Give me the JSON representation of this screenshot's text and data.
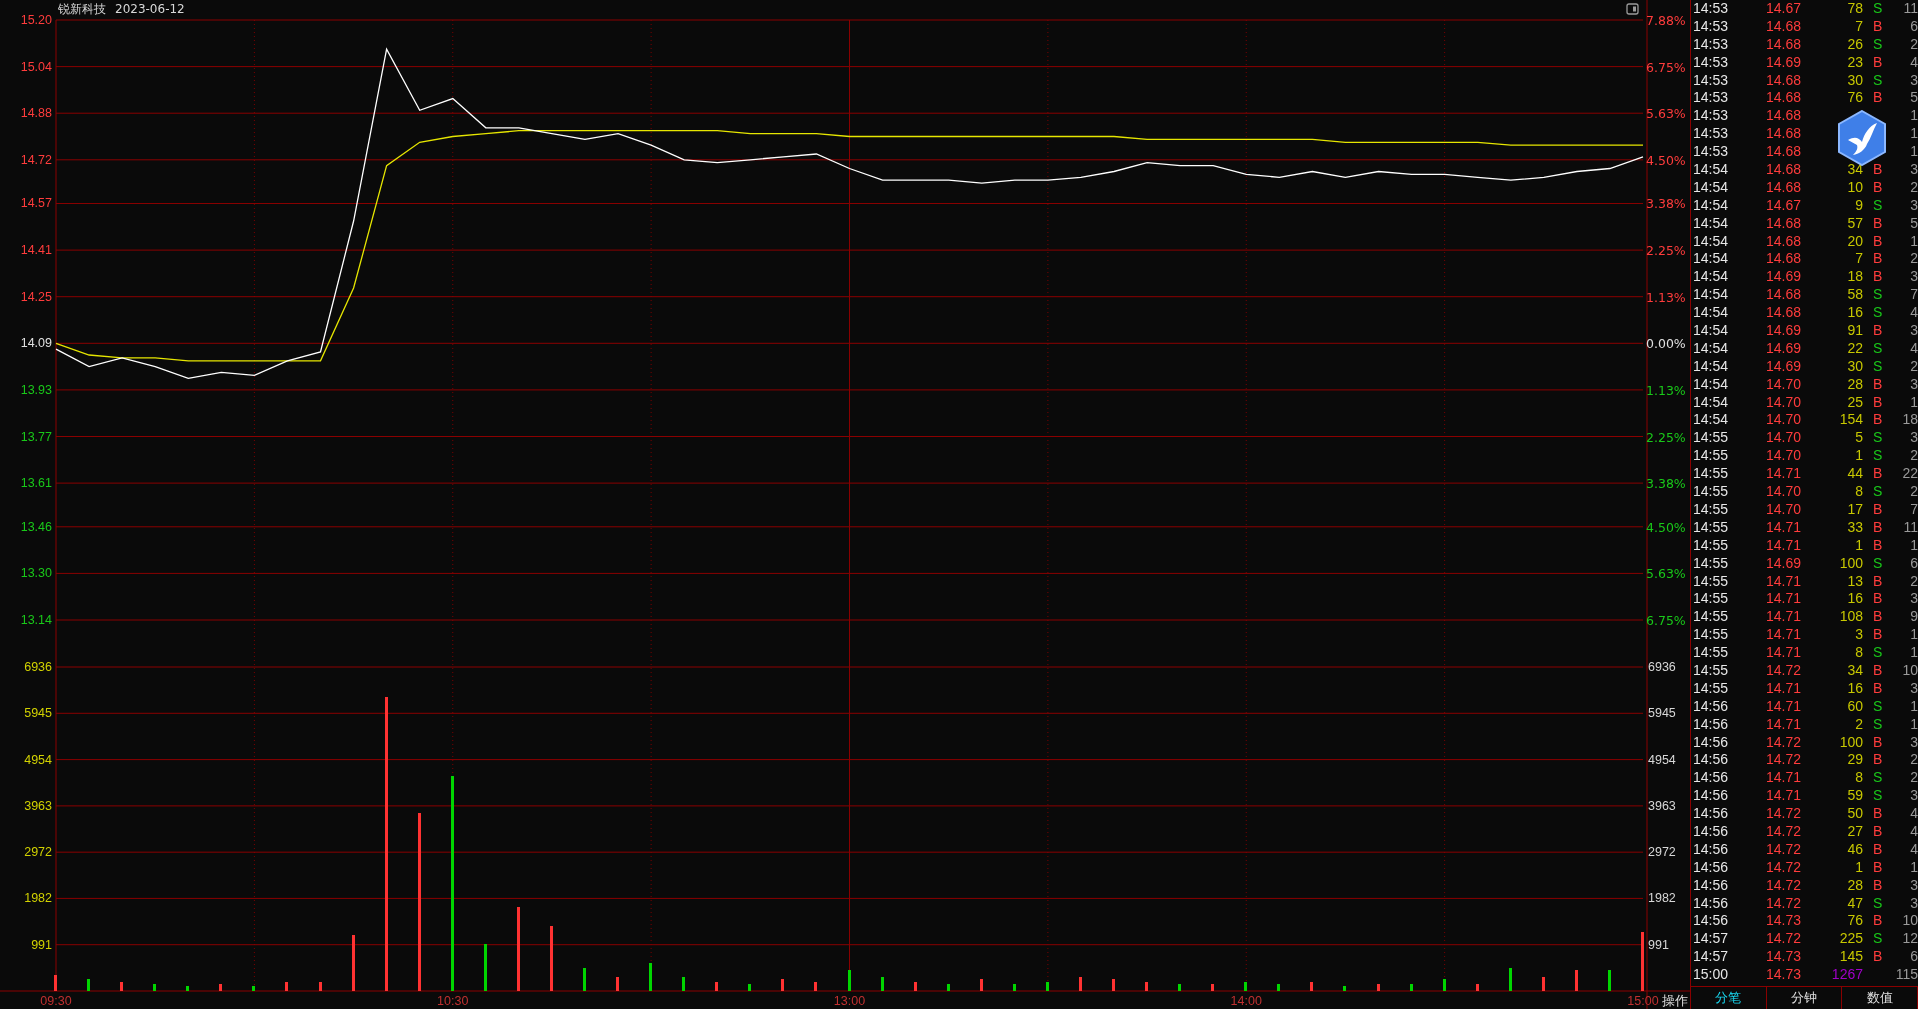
{
  "header": {
    "name": "锐新科技",
    "date": "2023-06-12"
  },
  "price_chart": {
    "chart_data": {
      "type": "line",
      "grid": true,
      "ylim": [
        13.14,
        15.2
      ],
      "yticks": [
        {
          "value": 15.2,
          "label": "15.20"
        },
        {
          "value": 15.04,
          "label": "15.04"
        },
        {
          "value": 14.88,
          "label": "14.88"
        },
        {
          "value": 14.72,
          "label": "14.72"
        },
        {
          "value": 14.57,
          "label": "14.57"
        },
        {
          "value": 14.41,
          "label": "14.41"
        },
        {
          "value": 14.25,
          "label": "14.25"
        },
        {
          "value": 14.09,
          "label": "14.09"
        },
        {
          "value": 13.93,
          "label": "13.93"
        },
        {
          "value": 13.77,
          "label": "13.77"
        },
        {
          "value": 13.61,
          "label": "13.61"
        },
        {
          "value": 13.46,
          "label": "13.46"
        },
        {
          "value": 13.3,
          "label": "13.30"
        },
        {
          "value": 13.14,
          "label": "13.14"
        }
      ],
      "series": [
        {
          "color": "#ffffff",
          "values": [
            14.07,
            14.01,
            14.04,
            14.01,
            13.97,
            13.99,
            13.98,
            14.03,
            14.06,
            14.51,
            15.1,
            14.89,
            14.93,
            14.83,
            14.83,
            14.81,
            14.79,
            14.81,
            14.77,
            14.72,
            14.71,
            14.72,
            14.73,
            14.74,
            14.69,
            14.65,
            14.65,
            14.65,
            14.64,
            14.65,
            14.65,
            14.66,
            14.68,
            14.71,
            14.7,
            14.7,
            14.67,
            14.66,
            14.68,
            14.66,
            14.68,
            14.67,
            14.67,
            14.66,
            14.65,
            14.66,
            14.68,
            14.69,
            14.73
          ]
        },
        {
          "color": "#e6e600",
          "values": [
            14.09,
            14.05,
            14.04,
            14.04,
            14.03,
            14.03,
            14.03,
            14.03,
            14.03,
            14.28,
            14.7,
            14.78,
            14.8,
            14.81,
            14.82,
            14.82,
            14.82,
            14.82,
            14.82,
            14.82,
            14.82,
            14.81,
            14.81,
            14.81,
            14.8,
            14.8,
            14.8,
            14.8,
            14.8,
            14.8,
            14.8,
            14.8,
            14.8,
            14.79,
            14.79,
            14.79,
            14.79,
            14.79,
            14.79,
            14.78,
            14.78,
            14.78,
            14.78,
            14.78,
            14.77,
            14.77,
            14.77,
            14.77,
            14.77
          ]
        }
      ]
    },
    "right_ticks": [
      {
        "label": "7.88%",
        "color": "#ff3c3c"
      },
      {
        "label": "6.75%",
        "color": "#ff3c3c"
      },
      {
        "label": "5.63%",
        "color": "#ff3c3c"
      },
      {
        "label": "4.50%",
        "color": "#ff3c3c"
      },
      {
        "label": "3.38%",
        "color": "#ff3c3c"
      },
      {
        "label": "2.25%",
        "color": "#ff3c3c"
      },
      {
        "label": "1.13%",
        "color": "#ff3c3c"
      },
      {
        "label": "0.00%",
        "color": "#e0e0e0"
      },
      {
        "label": "1.13%",
        "color": "#19c819"
      },
      {
        "label": "2.25%",
        "color": "#19c819"
      },
      {
        "label": "3.38%",
        "color": "#19c819"
      },
      {
        "label": "4.50%",
        "color": "#19c819"
      },
      {
        "label": "5.63%",
        "color": "#19c819"
      },
      {
        "label": "6.75%",
        "color": "#19c819"
      }
    ]
  },
  "volume_chart": {
    "chart_data": {
      "type": "bar",
      "grid": true,
      "categories": [
        "09:30",
        null,
        null,
        null,
        null,
        null,
        null,
        null,
        null,
        null,
        null,
        null,
        "10:30",
        null,
        null,
        null,
        null,
        null,
        null,
        null,
        null,
        null,
        null,
        null,
        "13:00",
        null,
        null,
        null,
        null,
        null,
        null,
        null,
        null,
        null,
        null,
        null,
        "14:00",
        null,
        null,
        null,
        null,
        null,
        null,
        null,
        null,
        null,
        null,
        null,
        "15:00"
      ],
      "ylim": [
        0,
        6936
      ],
      "yticks": [
        6936,
        5945,
        4954,
        3963,
        2972,
        1982,
        991
      ],
      "series": [
        {
          "values": [
            350,
            250,
            200,
            150,
            100,
            150,
            100,
            200,
            200,
            1200,
            6300,
            3800,
            4600,
            1000,
            1800,
            1400,
            500,
            300,
            600,
            300,
            200,
            150,
            250,
            200,
            450,
            300,
            200,
            150,
            250,
            150,
            200,
            300,
            250,
            200,
            150,
            150,
            200,
            150,
            200,
            100,
            150,
            150,
            250,
            150,
            500,
            300,
            450,
            450,
            1270
          ]
        }
      ]
    },
    "bar_up": [
      true,
      false,
      true,
      false,
      false,
      true,
      false,
      true,
      true,
      true,
      true,
      true,
      false,
      false,
      true,
      true,
      false,
      true,
      false,
      false,
      true,
      false,
      true,
      true,
      false,
      false,
      true,
      false,
      true,
      false,
      false,
      true,
      true,
      true,
      false,
      true,
      false,
      false,
      true,
      false,
      true,
      false,
      false,
      true,
      false,
      true,
      true,
      false,
      true
    ],
    "right_ticks": [
      "6936",
      "5945",
      "4954",
      "3963",
      "2972",
      "1982",
      "991"
    ]
  },
  "action_label": "操作",
  "trades": [
    {
      "kind": "trade",
      "time": "14:53",
      "price": "14.67",
      "volume": "78",
      "side": "S",
      "buy": false,
      "count": "11"
    },
    {
      "kind": "trade",
      "time": "14:53",
      "price": "14.68",
      "volume": "7",
      "side": "B",
      "buy": true,
      "count": "6"
    },
    {
      "kind": "trade",
      "time": "14:53",
      "price": "14.68",
      "volume": "26",
      "side": "S",
      "buy": false,
      "count": "2"
    },
    {
      "kind": "trade",
      "time": "14:53",
      "price": "14.69",
      "volume": "23",
      "side": "B",
      "buy": true,
      "count": "4"
    },
    {
      "kind": "trade",
      "time": "14:53",
      "price": "14.68",
      "volume": "30",
      "side": "S",
      "buy": false,
      "count": "3"
    },
    {
      "kind": "trade",
      "time": "14:53",
      "price": "14.68",
      "volume": "76",
      "side": "B",
      "buy": true,
      "count": "5"
    },
    {
      "kind": "trade",
      "time": "14:53",
      "price": "14.68",
      "count": "1"
    },
    {
      "kind": "trade",
      "time": "14:53",
      "price": "14.68",
      "count": "1"
    },
    {
      "kind": "trade",
      "time": "14:53",
      "price": "14.68",
      "count": "1"
    },
    {
      "kind": "trade",
      "time": "14:54",
      "price": "14.68",
      "volume": "34",
      "side": "B",
      "buy": true,
      "count": "3"
    },
    {
      "kind": "trade",
      "time": "14:54",
      "price": "14.68",
      "volume": "10",
      "side": "B",
      "buy": true,
      "count": "2"
    },
    {
      "kind": "trade",
      "time": "14:54",
      "price": "14.67",
      "volume": "9",
      "side": "S",
      "buy": false,
      "count": "3"
    },
    {
      "kind": "trade",
      "time": "14:54",
      "price": "14.68",
      "volume": "57",
      "side": "B",
      "buy": true,
      "count": "5"
    },
    {
      "kind": "trade",
      "time": "14:54",
      "price": "14.68",
      "volume": "20",
      "side": "B",
      "buy": true,
      "count": "1"
    },
    {
      "kind": "trade",
      "time": "14:54",
      "price": "14.68",
      "volume": "7",
      "side": "B",
      "buy": true,
      "count": "2"
    },
    {
      "kind": "trade",
      "time": "14:54",
      "price": "14.69",
      "volume": "18",
      "side": "B",
      "buy": true,
      "count": "3"
    },
    {
      "kind": "trade",
      "time": "14:54",
      "price": "14.68",
      "volume": "58",
      "side": "S",
      "buy": false,
      "count": "7"
    },
    {
      "kind": "trade",
      "time": "14:54",
      "price": "14.68",
      "volume": "16",
      "side": "S",
      "buy": false,
      "count": "4"
    },
    {
      "kind": "trade",
      "time": "14:54",
      "price": "14.69",
      "volume": "91",
      "side": "B",
      "buy": true,
      "count": "3"
    },
    {
      "kind": "trade",
      "time": "14:54",
      "price": "14.69",
      "volume": "22",
      "side": "S",
      "buy": false,
      "count": "4"
    },
    {
      "kind": "trade",
      "time": "14:54",
      "price": "14.69",
      "volume": "30",
      "side": "S",
      "buy": false,
      "count": "2"
    },
    {
      "kind": "trade",
      "time": "14:54",
      "price": "14.70",
      "volume": "28",
      "side": "B",
      "buy": true,
      "count": "3"
    },
    {
      "kind": "trade",
      "time": "14:54",
      "price": "14.70",
      "volume": "25",
      "side": "B",
      "buy": true,
      "count": "1"
    },
    {
      "kind": "trade",
      "time": "14:54",
      "price": "14.70",
      "volume": "154",
      "side": "B",
      "buy": true,
      "count": "18"
    },
    {
      "kind": "trade",
      "time": "14:55",
      "price": "14.70",
      "volume": "5",
      "side": "S",
      "buy": false,
      "count": "3"
    },
    {
      "kind": "trade",
      "time": "14:55",
      "price": "14.70",
      "volume": "1",
      "side": "S",
      "buy": false,
      "count": "2"
    },
    {
      "kind": "trade",
      "time": "14:55",
      "price": "14.71",
      "volume": "44",
      "side": "B",
      "buy": true,
      "count": "22"
    },
    {
      "kind": "trade",
      "time": "14:55",
      "price": "14.70",
      "volume": "8",
      "side": "S",
      "buy": false,
      "count": "2"
    },
    {
      "kind": "trade",
      "time": "14:55",
      "price": "14.70",
      "volume": "17",
      "side": "B",
      "buy": true,
      "count": "7"
    },
    {
      "kind": "trade",
      "time": "14:55",
      "price": "14.71",
      "volume": "33",
      "side": "B",
      "buy": true,
      "count": "11"
    },
    {
      "kind": "trade",
      "time": "14:55",
      "price": "14.71",
      "volume": "1",
      "side": "B",
      "buy": true,
      "count": "1"
    },
    {
      "kind": "trade",
      "time": "14:55",
      "price": "14.69",
      "volume": "100",
      "side": "S",
      "buy": false,
      "count": "6"
    },
    {
      "kind": "trade",
      "time": "14:55",
      "price": "14.71",
      "volume": "13",
      "side": "B",
      "buy": true,
      "count": "2"
    },
    {
      "kind": "trade",
      "time": "14:55",
      "price": "14.71",
      "volume": "16",
      "side": "B",
      "buy": true,
      "count": "3"
    },
    {
      "kind": "trade",
      "time": "14:55",
      "price": "14.71",
      "volume": "108",
      "side": "B",
      "buy": true,
      "count": "9"
    },
    {
      "kind": "trade",
      "time": "14:55",
      "price": "14.71",
      "volume": "3",
      "side": "B",
      "buy": true,
      "count": "1"
    },
    {
      "kind": "trade",
      "time": "14:55",
      "price": "14.71",
      "volume": "8",
      "side": "S",
      "buy": false,
      "count": "1"
    },
    {
      "kind": "trade",
      "time": "14:55",
      "price": "14.72",
      "volume": "34",
      "side": "B",
      "buy": true,
      "count": "10"
    },
    {
      "kind": "trade",
      "time": "14:55",
      "price": "14.71",
      "volume": "16",
      "side": "B",
      "buy": true,
      "count": "3"
    },
    {
      "kind": "trade",
      "time": "14:56",
      "price": "14.71",
      "volume": "60",
      "side": "S",
      "buy": false,
      "count": "1"
    },
    {
      "kind": "trade",
      "time": "14:56",
      "price": "14.71",
      "volume": "2",
      "side": "S",
      "buy": false,
      "count": "1"
    },
    {
      "kind": "trade",
      "time": "14:56",
      "price": "14.72",
      "volume": "100",
      "side": "B",
      "buy": true,
      "count": "3"
    },
    {
      "kind": "trade",
      "time": "14:56",
      "price": "14.72",
      "volume": "29",
      "side": "B",
      "buy": true,
      "count": "2"
    },
    {
      "kind": "trade",
      "time": "14:56",
      "price": "14.71",
      "volume": "8",
      "side": "S",
      "buy": false,
      "count": "2"
    },
    {
      "kind": "trade",
      "time": "14:56",
      "price": "14.71",
      "volume": "59",
      "side": "S",
      "buy": false,
      "count": "3"
    },
    {
      "kind": "trade",
      "time": "14:56",
      "price": "14.72",
      "volume": "50",
      "side": "B",
      "buy": true,
      "count": "4"
    },
    {
      "kind": "trade",
      "time": "14:56",
      "price": "14.72",
      "volume": "27",
      "side": "B",
      "buy": true,
      "count": "4"
    },
    {
      "kind": "trade",
      "time": "14:56",
      "price": "14.72",
      "volume": "46",
      "side": "B",
      "buy": true,
      "count": "4"
    },
    {
      "kind": "trade",
      "time": "14:56",
      "price": "14.72",
      "volume": "1",
      "side": "B",
      "buy": true,
      "count": "1"
    },
    {
      "kind": "trade",
      "time": "14:56",
      "price": "14.72",
      "volume": "28",
      "side": "B",
      "buy": true,
      "count": "3"
    },
    {
      "kind": "trade",
      "time": "14:56",
      "price": "14.72",
      "volume": "47",
      "side": "S",
      "buy": false,
      "count": "3"
    },
    {
      "kind": "trade",
      "time": "14:56",
      "price": "14.73",
      "volume": "76",
      "side": "B",
      "buy": true,
      "count": "10"
    },
    {
      "kind": "trade",
      "time": "14:57",
      "price": "14.72",
      "volume": "225",
      "side": "S",
      "buy": false,
      "count": "12"
    },
    {
      "kind": "trade",
      "time": "14:57",
      "price": "14.73",
      "volume": "145",
      "side": "B",
      "buy": true,
      "count": "6"
    },
    {
      "kind": "closing",
      "time": "15:00",
      "price": "14.73",
      "volume": "1267",
      "count": "115"
    }
  ],
  "tabs": [
    {
      "label": "分笔",
      "selected": true
    },
    {
      "label": "分钟",
      "selected": false
    },
    {
      "label": "数值",
      "selected": false
    }
  ]
}
